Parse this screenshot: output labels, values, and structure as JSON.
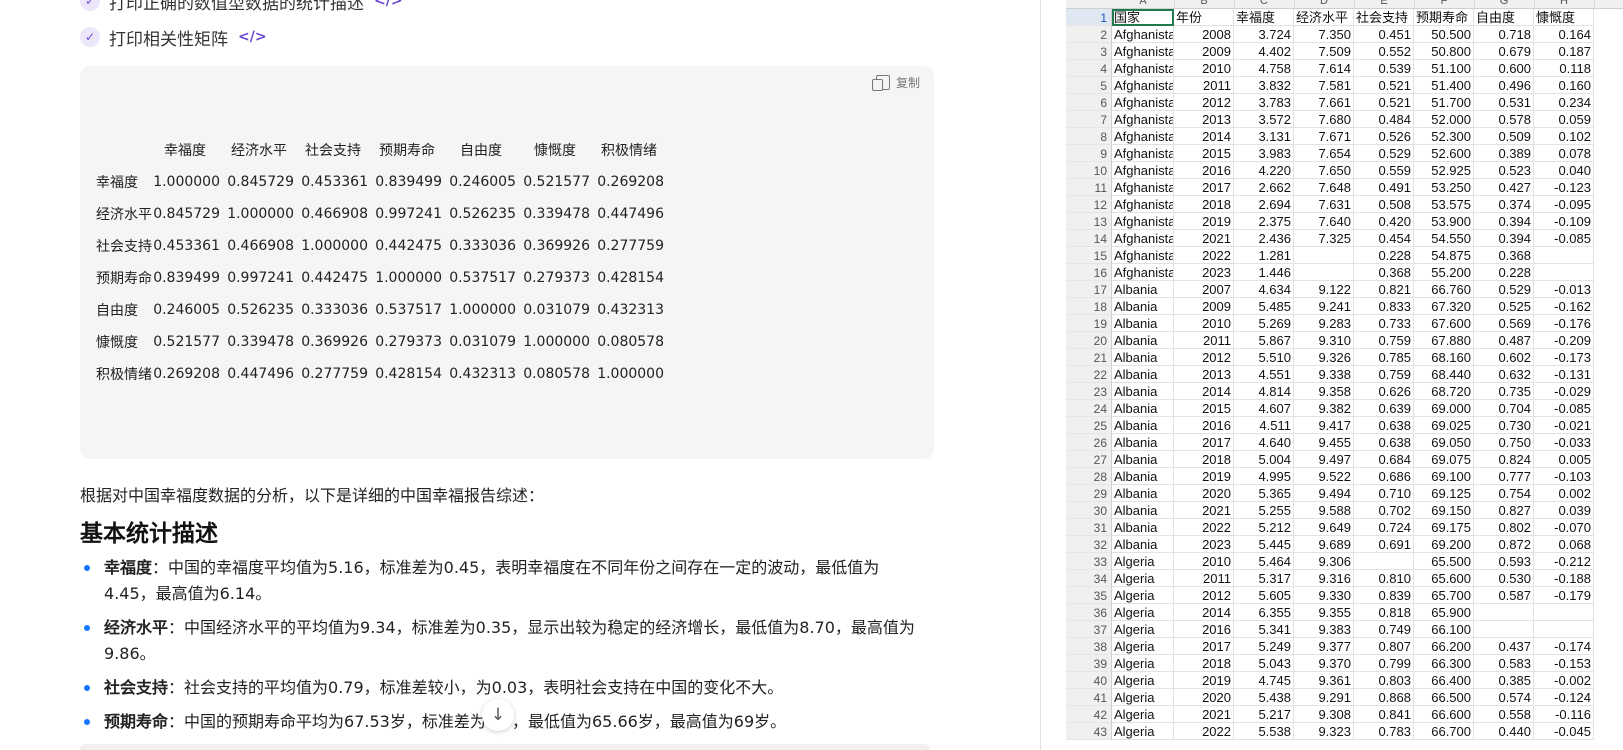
{
  "chat": {
    "steps": [
      {
        "label": "打印正确的数值型数据的统计描述",
        "code_icon": "</>"
      },
      {
        "label": "打印相关性矩阵",
        "code_icon": "</>"
      }
    ],
    "code_block": {
      "copy_label": "复制",
      "matrix": {
        "columns": [
          "幸福度",
          "经济水平",
          "社会支持",
          "预期寿命",
          "自由度",
          "慷慨度",
          "积极情绪"
        ],
        "rows": [
          {
            "label": "幸福度",
            "values": [
              "1.000000",
              "0.845729",
              "0.453361",
              "0.839499",
              "0.246005",
              "0.521577",
              "0.269208"
            ]
          },
          {
            "label": "经济水平",
            "values": [
              "0.845729",
              "1.000000",
              "0.466908",
              "0.997241",
              "0.526235",
              "0.339478",
              "0.447496"
            ]
          },
          {
            "label": "社会支持",
            "values": [
              "0.453361",
              "0.466908",
              "1.000000",
              "0.442475",
              "0.333036",
              "0.369926",
              "0.277759"
            ]
          },
          {
            "label": "预期寿命",
            "values": [
              "0.839499",
              "0.997241",
              "0.442475",
              "1.000000",
              "0.537517",
              "0.279373",
              "0.428154"
            ]
          },
          {
            "label": "自由度",
            "values": [
              "0.246005",
              "0.526235",
              "0.333036",
              "0.537517",
              "1.000000",
              "0.031079",
              "0.432313"
            ]
          },
          {
            "label": "慷慨度",
            "values": [
              "0.521577",
              "0.339478",
              "0.369926",
              "0.279373",
              "0.031079",
              "1.000000",
              "0.080578"
            ]
          },
          {
            "label": "积极情绪",
            "values": [
              "0.269208",
              "0.447496",
              "0.277759",
              "0.428154",
              "0.432313",
              "0.080578",
              "1.000000"
            ]
          }
        ]
      }
    },
    "summary_intro": "根据对中国幸福度数据的分析，以下是详细的中国幸福报告综述：",
    "section_heading": "基本统计描述",
    "stats": [
      {
        "term": "幸福度",
        "text": "：中国的幸福度平均值为5.16，标准差为0.45，表明幸福度在不同年份之间存在一定的波动，最低值为4.45，最高值为6.14。"
      },
      {
        "term": "经济水平",
        "text": "：中国经济水平的平均值为9.34，标准差为0.35，显示出较为稳定的经济增长，最低值为8.70，最高值为9.86。"
      },
      {
        "term": "社会支持",
        "text": "：社会支持的平均值为0.79，标准差较小，为0.03，表明社会支持在中国的变化不大。"
      },
      {
        "term": "预期寿命",
        "text": "：中国的预期寿命平均为67.53岁，标准差为1岁，最低值为65.66岁，最高值为69岁。"
      }
    ],
    "scroll_down_icon": "arrow-down-icon"
  },
  "sheet": {
    "col_letters": [
      "A",
      "B",
      "C",
      "D",
      "E",
      "F",
      "G",
      "H"
    ],
    "rows": [
      [
        "国家",
        "年份",
        "幸福度",
        "经济水平",
        "社会支持",
        "预期寿命",
        "自由度",
        "慷慨度"
      ],
      [
        "Afghanistan",
        "2008",
        "3.724",
        "7.350",
        "0.451",
        "50.500",
        "0.718",
        "0.164"
      ],
      [
        "Afghanistan",
        "2009",
        "4.402",
        "7.509",
        "0.552",
        "50.800",
        "0.679",
        "0.187"
      ],
      [
        "Afghanistan",
        "2010",
        "4.758",
        "7.614",
        "0.539",
        "51.100",
        "0.600",
        "0.118"
      ],
      [
        "Afghanistan",
        "2011",
        "3.832",
        "7.581",
        "0.521",
        "51.400",
        "0.496",
        "0.160"
      ],
      [
        "Afghanistan",
        "2012",
        "3.783",
        "7.661",
        "0.521",
        "51.700",
        "0.531",
        "0.234"
      ],
      [
        "Afghanistan",
        "2013",
        "3.572",
        "7.680",
        "0.484",
        "52.000",
        "0.578",
        "0.059"
      ],
      [
        "Afghanistan",
        "2014",
        "3.131",
        "7.671",
        "0.526",
        "52.300",
        "0.509",
        "0.102"
      ],
      [
        "Afghanistan",
        "2015",
        "3.983",
        "7.654",
        "0.529",
        "52.600",
        "0.389",
        "0.078"
      ],
      [
        "Afghanistan",
        "2016",
        "4.220",
        "7.650",
        "0.559",
        "52.925",
        "0.523",
        "0.040"
      ],
      [
        "Afghanistan",
        "2017",
        "2.662",
        "7.648",
        "0.491",
        "53.250",
        "0.427",
        "-0.123"
      ],
      [
        "Afghanistan",
        "2018",
        "2.694",
        "7.631",
        "0.508",
        "53.575",
        "0.374",
        "-0.095"
      ],
      [
        "Afghanistan",
        "2019",
        "2.375",
        "7.640",
        "0.420",
        "53.900",
        "0.394",
        "-0.109"
      ],
      [
        "Afghanistan",
        "2021",
        "2.436",
        "7.325",
        "0.454",
        "54.550",
        "0.394",
        "-0.085"
      ],
      [
        "Afghanistan",
        "2022",
        "1.281",
        "",
        "0.228",
        "54.875",
        "0.368",
        ""
      ],
      [
        "Afghanistan",
        "2023",
        "1.446",
        "",
        "0.368",
        "55.200",
        "0.228",
        ""
      ],
      [
        "Albania",
        "2007",
        "4.634",
        "9.122",
        "0.821",
        "66.760",
        "0.529",
        "-0.013"
      ],
      [
        "Albania",
        "2009",
        "5.485",
        "9.241",
        "0.833",
        "67.320",
        "0.525",
        "-0.162"
      ],
      [
        "Albania",
        "2010",
        "5.269",
        "9.283",
        "0.733",
        "67.600",
        "0.569",
        "-0.176"
      ],
      [
        "Albania",
        "2011",
        "5.867",
        "9.310",
        "0.759",
        "67.880",
        "0.487",
        "-0.209"
      ],
      [
        "Albania",
        "2012",
        "5.510",
        "9.326",
        "0.785",
        "68.160",
        "0.602",
        "-0.173"
      ],
      [
        "Albania",
        "2013",
        "4.551",
        "9.338",
        "0.759",
        "68.440",
        "0.632",
        "-0.131"
      ],
      [
        "Albania",
        "2014",
        "4.814",
        "9.358",
        "0.626",
        "68.720",
        "0.735",
        "-0.029"
      ],
      [
        "Albania",
        "2015",
        "4.607",
        "9.382",
        "0.639",
        "69.000",
        "0.704",
        "-0.085"
      ],
      [
        "Albania",
        "2016",
        "4.511",
        "9.417",
        "0.638",
        "69.025",
        "0.730",
        "-0.021"
      ],
      [
        "Albania",
        "2017",
        "4.640",
        "9.455",
        "0.638",
        "69.050",
        "0.750",
        "-0.033"
      ],
      [
        "Albania",
        "2018",
        "5.004",
        "9.497",
        "0.684",
        "69.075",
        "0.824",
        "0.005"
      ],
      [
        "Albania",
        "2019",
        "4.995",
        "9.522",
        "0.686",
        "69.100",
        "0.777",
        "-0.103"
      ],
      [
        "Albania",
        "2020",
        "5.365",
        "9.494",
        "0.710",
        "69.125",
        "0.754",
        "0.002"
      ],
      [
        "Albania",
        "2021",
        "5.255",
        "9.588",
        "0.702",
        "69.150",
        "0.827",
        "0.039"
      ],
      [
        "Albania",
        "2022",
        "5.212",
        "9.649",
        "0.724",
        "69.175",
        "0.802",
        "-0.070"
      ],
      [
        "Albania",
        "2023",
        "5.445",
        "9.689",
        "0.691",
        "69.200",
        "0.872",
        "0.068"
      ],
      [
        "Algeria",
        "2010",
        "5.464",
        "9.306",
        "",
        "65.500",
        "0.593",
        "-0.212"
      ],
      [
        "Algeria",
        "2011",
        "5.317",
        "9.316",
        "0.810",
        "65.600",
        "0.530",
        "-0.188"
      ],
      [
        "Algeria",
        "2012",
        "5.605",
        "9.330",
        "0.839",
        "65.700",
        "0.587",
        "-0.179"
      ],
      [
        "Algeria",
        "2014",
        "6.355",
        "9.355",
        "0.818",
        "65.900",
        "",
        ""
      ],
      [
        "Algeria",
        "2016",
        "5.341",
        "9.383",
        "0.749",
        "66.100",
        "",
        ""
      ],
      [
        "Algeria",
        "2017",
        "5.249",
        "9.377",
        "0.807",
        "66.200",
        "0.437",
        "-0.174"
      ],
      [
        "Algeria",
        "2018",
        "5.043",
        "9.370",
        "0.799",
        "66.300",
        "0.583",
        "-0.153"
      ],
      [
        "Algeria",
        "2019",
        "4.745",
        "9.361",
        "0.803",
        "66.400",
        "0.385",
        "-0.002"
      ],
      [
        "Algeria",
        "2020",
        "5.438",
        "9.291",
        "0.868",
        "66.500",
        "0.574",
        "-0.124"
      ],
      [
        "Algeria",
        "2021",
        "5.217",
        "9.308",
        "0.841",
        "66.600",
        "0.558",
        "-0.116"
      ],
      [
        "Algeria",
        "2022",
        "5.538",
        "9.323",
        "0.783",
        "66.700",
        "0.440",
        "-0.045"
      ]
    ]
  }
}
